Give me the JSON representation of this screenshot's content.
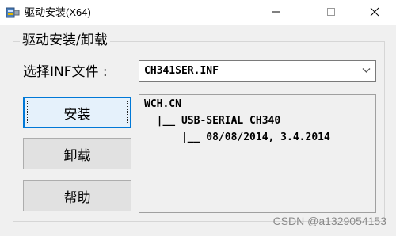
{
  "window": {
    "title": "驱动安装(X64)",
    "icon": "usb-installer-icon"
  },
  "group": {
    "legend": "驱动安装/卸载"
  },
  "inf": {
    "label": "选择INF文件 :",
    "selected": "CH341SER.INF"
  },
  "buttons": {
    "install": "安装",
    "uninstall": "卸载",
    "help": "帮助"
  },
  "info": {
    "lines": [
      "WCH.CN",
      "  |__ USB-SERIAL CH340",
      "      |__ 08/08/2014, 3.4.2014"
    ]
  },
  "watermark": "CSDN @a1329054153",
  "colors": {
    "focus": "#0078d7",
    "background": "#f0f0f0"
  }
}
